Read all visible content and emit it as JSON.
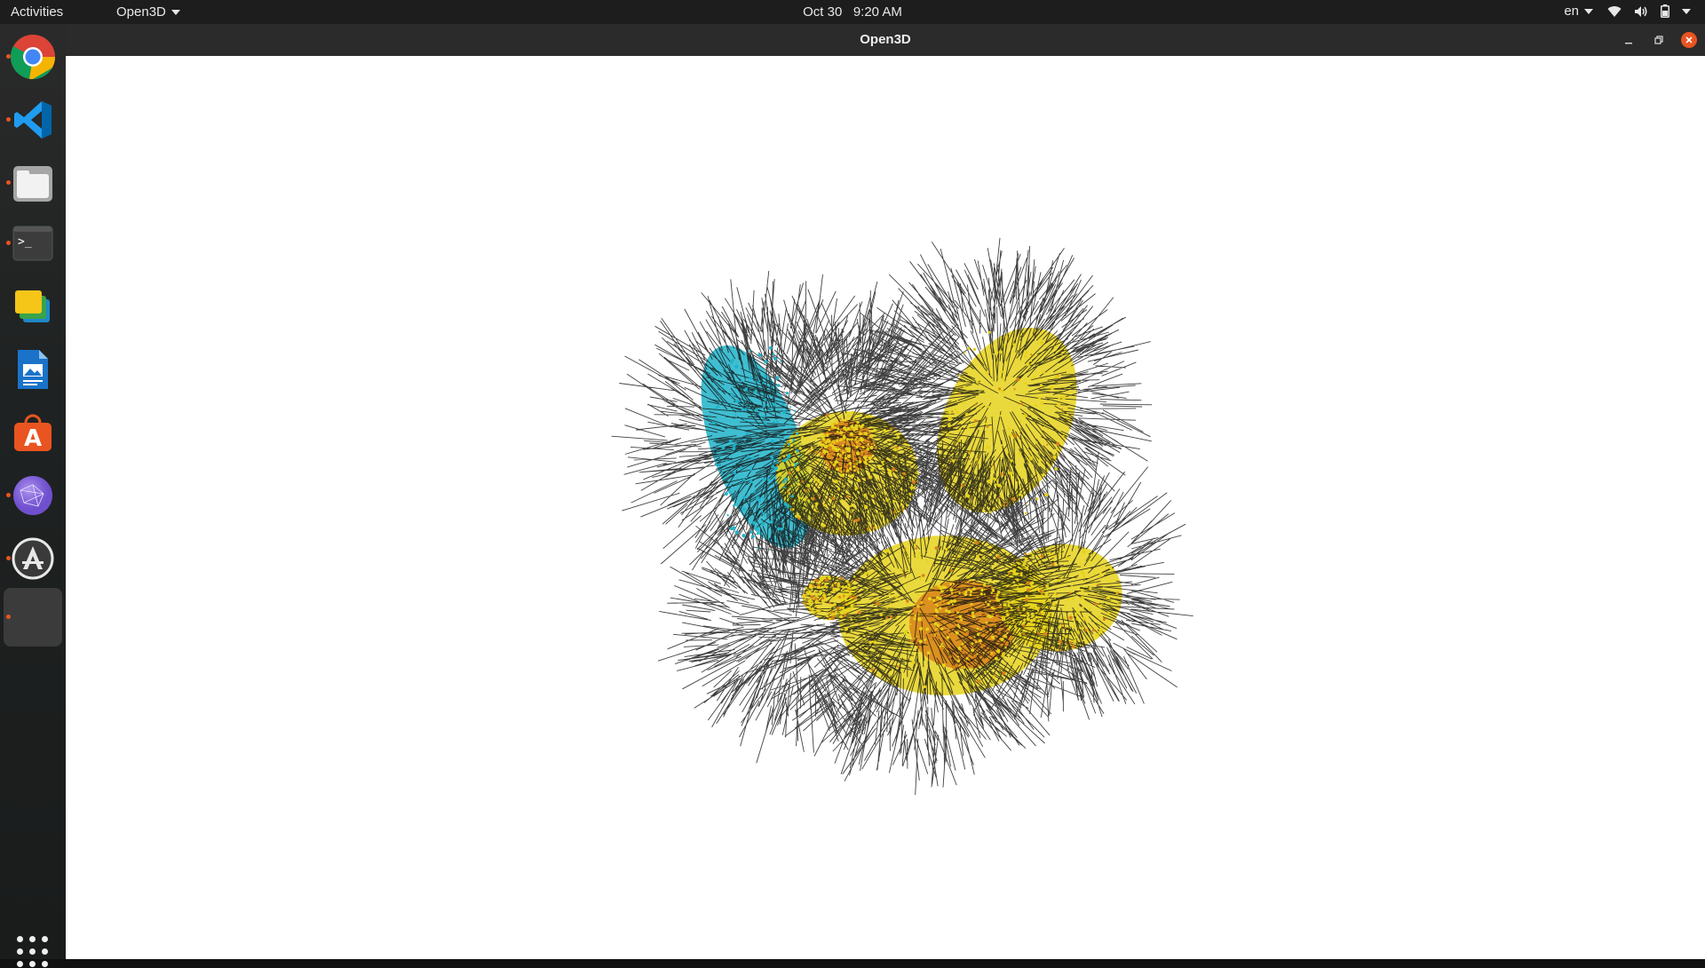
{
  "topbar": {
    "activities": "Activities",
    "app_menu": "Open3D",
    "date": "Oct 30",
    "time": "9:20 AM",
    "language": "en",
    "icons": [
      "wifi-icon",
      "volume-icon",
      "battery-icon",
      "system-menu-caret-icon"
    ]
  },
  "dock": {
    "items": [
      {
        "name": "chrome",
        "running": true
      },
      {
        "name": "vscode",
        "running": true
      },
      {
        "name": "files",
        "running": true
      },
      {
        "name": "terminal",
        "running": true
      },
      {
        "name": "slides",
        "running": false
      },
      {
        "name": "writer",
        "running": false
      },
      {
        "name": "software-center",
        "running": false
      },
      {
        "name": "network-app",
        "running": true
      },
      {
        "name": "software-updater",
        "running": true
      },
      {
        "name": "open3d",
        "running": true,
        "active": true
      }
    ],
    "show_apps": "apps-grid-icon"
  },
  "window": {
    "title": "Open3D",
    "controls": [
      "minimize",
      "maximize",
      "close"
    ]
  },
  "colors": {
    "accent": "#e95420",
    "topbar": "#1d1d1d",
    "titlebar": "#2b2b2b",
    "viewport_bg": "#ffffff",
    "normals": "#111111",
    "cloud_yellow": "#e6d21a",
    "cloud_orange": "#d9821a",
    "cloud_cyan": "#1fb3c9"
  }
}
